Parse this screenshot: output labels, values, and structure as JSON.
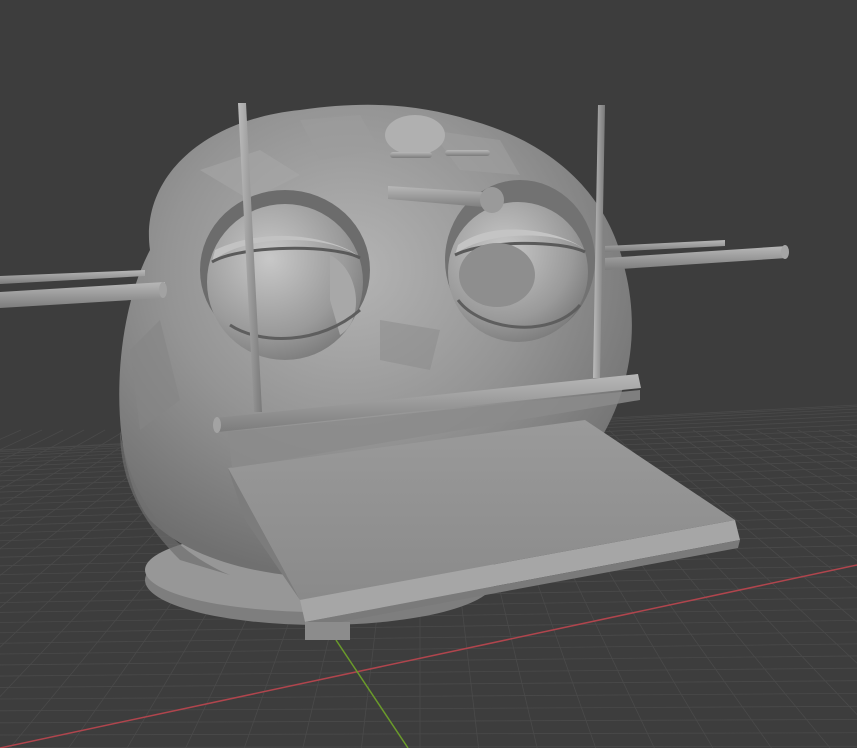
{
  "viewport": {
    "background": "#3d3d3d",
    "grid_color": "#4a4a4a",
    "x_axis_color": "#b0454d",
    "y_axis_color": "#6a9b2a"
  },
  "model": {
    "surface_color": "#8e8e8e",
    "shadow_color": "#6d6d6d",
    "highlight_color": "#b2b2b2",
    "icons": [
      "cartoon-head-mesh",
      "eye-sphere",
      "rod",
      "base-disc",
      "tray-plate"
    ]
  }
}
